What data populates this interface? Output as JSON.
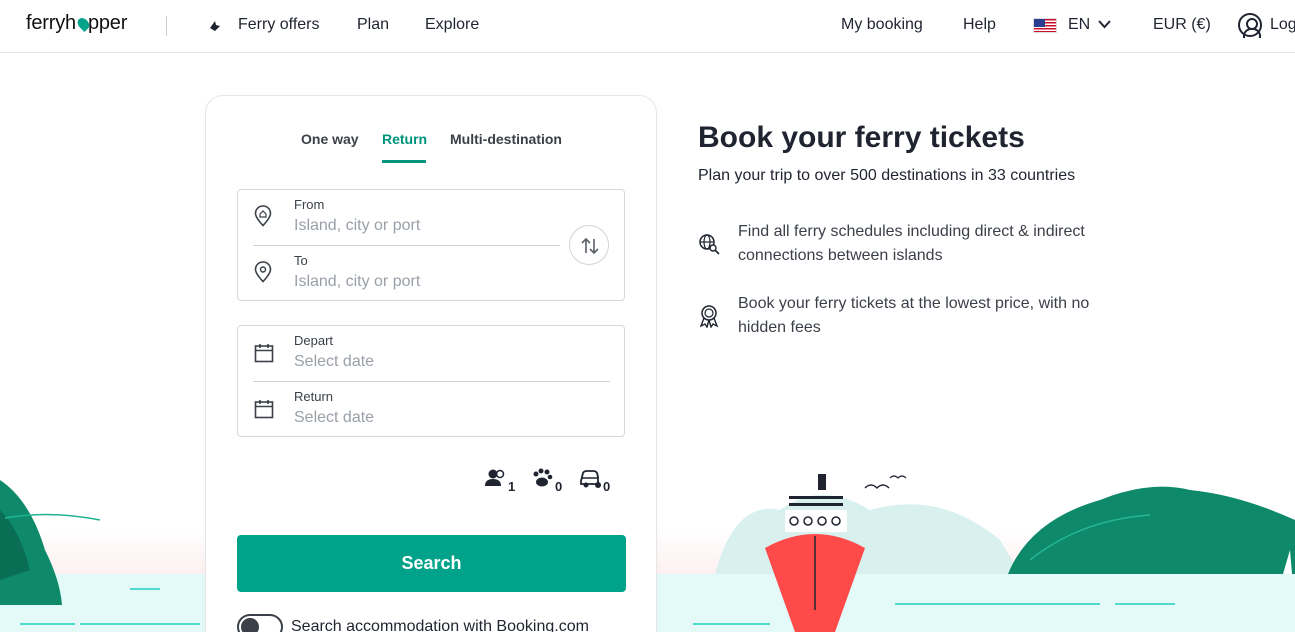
{
  "nav": {
    "logo": "ferryhopper",
    "items": [
      "Ferry offers",
      "Plan",
      "Explore"
    ],
    "my_booking": "My booking",
    "help": "Help",
    "language": "EN",
    "currency": "EUR (€)",
    "login": "Log"
  },
  "search": {
    "tabs": [
      "One way",
      "Return",
      "Multi-destination"
    ],
    "active_tab": "Return",
    "from_label": "From",
    "from_placeholder": "Island, city or port",
    "to_label": "To",
    "to_placeholder": "Island, city or port",
    "depart_label": "Depart",
    "depart_placeholder": "Select date",
    "return_label": "Return",
    "return_placeholder": "Select date",
    "passengers": "1",
    "pets": "0",
    "vehicles": "0",
    "button": "Search",
    "accommodation_toggle": "Search accommodation with Booking.com"
  },
  "hero": {
    "title": "Book your ferry tickets",
    "subtitle": "Plan your trip to over 500 destinations in 33 countries",
    "features": [
      "Find all ferry schedules including direct & indirect connections between islands",
      "Book your ferry tickets at the lowest price, with no hidden fees"
    ]
  },
  "colors": {
    "accent": "#00a38a",
    "ship": "#ff4a4a"
  }
}
